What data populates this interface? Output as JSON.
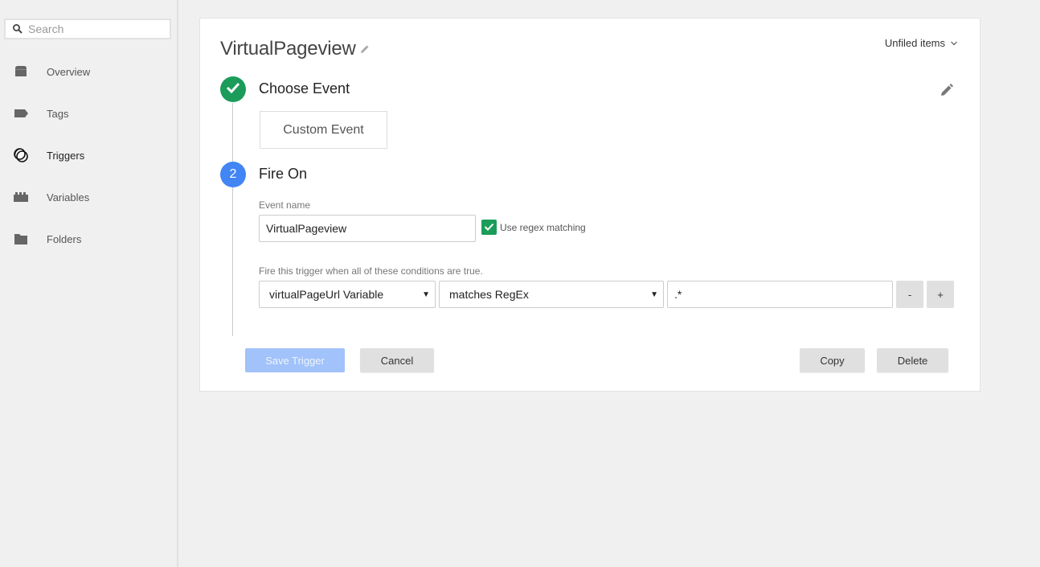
{
  "sidebar": {
    "search": {
      "placeholder": "Search",
      "value": ""
    },
    "items": [
      {
        "label": "Overview",
        "icon": "overview-icon",
        "active": false
      },
      {
        "label": "Tags",
        "icon": "tag-icon",
        "active": false
      },
      {
        "label": "Triggers",
        "icon": "trigger-icon",
        "active": true
      },
      {
        "label": "Variables",
        "icon": "variable-icon",
        "active": false
      },
      {
        "label": "Folders",
        "icon": "folder-icon",
        "active": false
      }
    ]
  },
  "trigger": {
    "name": "VirtualPageview",
    "folder": "Unfiled items",
    "step1": {
      "title": "Choose Event",
      "event_type": "Custom Event"
    },
    "step2": {
      "number": "2",
      "title": "Fire On",
      "event_name_label": "Event name",
      "event_name_value": "VirtualPageview",
      "regex_label": "Use regex matching",
      "regex_checked": true,
      "conditions_label": "Fire this trigger when all of these conditions are true.",
      "condition": {
        "variable": "virtualPageUrl Variable",
        "operator": "matches RegEx",
        "value": ".*"
      },
      "remove_label": "-",
      "add_label": "+"
    },
    "buttons": {
      "save": "Save Trigger",
      "cancel": "Cancel",
      "copy": "Copy",
      "delete": "Delete"
    }
  },
  "colors": {
    "step_complete": "#1c9c5a",
    "step_active": "#4285f4",
    "primary_disabled": "#a1c2fa"
  }
}
